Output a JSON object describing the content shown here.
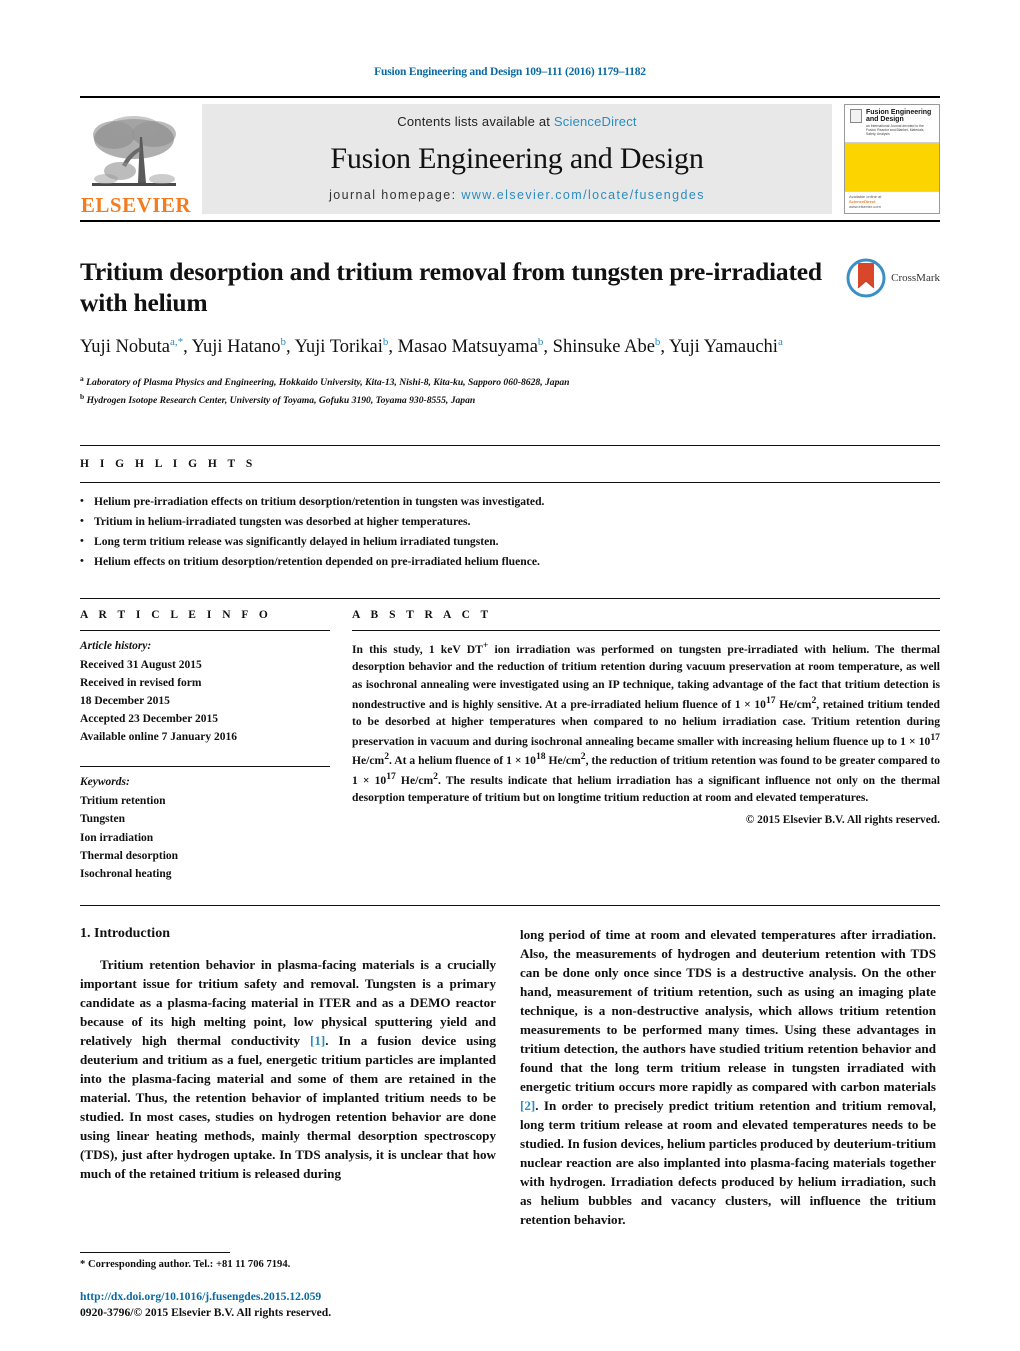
{
  "running_head": "Fusion Engineering and Design 109–111 (2016) 1179–1182",
  "masthead": {
    "publisher_name": "ELSEVIER",
    "contents_prefix": "Contents lists available at ",
    "contents_link": "ScienceDirect",
    "journal_title": "Fusion Engineering and Design",
    "homepage_label": "journal homepage: ",
    "homepage_url": "www.elsevier.com/locate/fusengdes",
    "cover": {
      "title_line1": "Fusion Engineering",
      "title_line2": "and Design",
      "subtitle": "an International Journal devoted to the Fusion Reactor and Blanket, Materials, Safety, Analysis",
      "footer_text": "Available online at",
      "footer_brand": "ScienceDirect",
      "footer_url": "www.elsevier.com"
    }
  },
  "article": {
    "title": "Tritium desorption and tritium removal from tungsten pre-irradiated with helium",
    "crossmark_label": "CrossMark",
    "authors_html": "Yuji Nobuta<sup>a,</sup><sup>*</sup>, Yuji Hatano<sup>b</sup>, Yuji Torikai<sup>b</sup>, Masao Matsuyama<sup>b</sup>, Shinsuke Abe<sup>b</sup>, Yuji Yamauchi<sup>a</sup>",
    "affiliations": [
      {
        "marker": "a",
        "text": "Laboratory of Plasma Physics and Engineering, Hokkaido University, Kita-13, Nishi-8, Kita-ku, Sapporo 060-8628, Japan"
      },
      {
        "marker": "b",
        "text": "Hydrogen Isotope Research Center, University of Toyama, Gofuku 3190, Toyama 930-8555, Japan"
      }
    ]
  },
  "highlights": {
    "heading": "H I G H L I G H T S",
    "items": [
      "Helium pre-irradiation effects on tritium desorption/retention in tungsten was investigated.",
      "Tritium in helium-irradiated tungsten was desorbed at higher temperatures.",
      "Long term tritium release was significantly delayed in helium irradiated tungsten.",
      "Helium effects on tritium desorption/retention depended on pre-irradiated helium fluence."
    ]
  },
  "article_info": {
    "heading": "A R T I C L E    I N F O",
    "history_label": "Article history:",
    "history_lines": [
      "Received 31 August 2015",
      "Received in revised form",
      "18 December 2015",
      "Accepted 23 December 2015",
      "Available online 7 January 2016"
    ],
    "keywords_label": "Keywords:",
    "keywords": [
      "Tritium retention",
      "Tungsten",
      "Ion irradiation",
      "Thermal desorption",
      "Isochronal heating"
    ]
  },
  "abstract": {
    "heading": "A B S T R A C T",
    "text_html": "In this study, 1 keV DT<sup>+</sup> ion irradiation was performed on tungsten pre-irradiated with helium. The thermal desorption behavior and the reduction of tritium retention during vacuum preservation at room temperature, as well as isochronal annealing were investigated using an IP technique, taking advantage of the fact that tritium detection is nondestructive and is highly sensitive. At a pre-irradiated helium fluence of 1 &times; 10<sup>17</sup> He/cm<sup>2</sup>, retained tritium tended to be desorbed at higher temperatures when compared to no helium irradiation case. Tritium retention during preservation in vacuum and during isochronal annealing became smaller with increasing helium fluence up to 1 &times; 10<sup>17</sup> He/cm<sup>2</sup>. At a helium fluence of 1 &times; 10<sup>18</sup> He/cm<sup>2</sup>, the reduction of tritium retention was found to be greater compared to 1 &times; 10<sup>17</sup> He/cm<sup>2</sup>. The results indicate that helium irradiation has a significant influence not only on the thermal desorption temperature of tritium but on longtime tritium reduction at room and elevated temperatures.",
    "copyright": "© 2015 Elsevier B.V. All rights reserved."
  },
  "body": {
    "section_heading": "1.  Introduction",
    "left_paragraph_html": "Tritium retention behavior in plasma-facing materials is a crucially important issue for tritium safety and removal. Tungsten is a primary candidate as a plasma-facing material in ITER and as a DEMO reactor because of its high melting point, low physical sputtering yield and relatively high thermal conductivity <span class=\"ref\">[1]</span>. In a fusion device using deuterium and tritium as a fuel, energetic tritium particles are implanted into the plasma-facing material and some of them are retained in the material. Thus, the retention behavior of implanted tritium needs to be studied. In most cases, studies on hydrogen retention behavior are done using linear heating methods, mainly thermal desorption spectroscopy (TDS), just after hydrogen uptake. In TDS analysis, it is unclear that how much of the retained tritium is released during",
    "right_paragraph_html": "long period of time at room and elevated temperatures after irradiation. Also, the measurements of hydrogen and deuterium retention with TDS can be done only once since TDS is a destructive analysis. On the other hand, measurement of tritium retention, such as using an imaging plate technique, is a non-destructive analysis, which allows tritium retention measurements to be performed many times. Using these advantages in tritium detection, the authors have studied tritium retention behavior and found that the long term tritium release in tungsten irradiated with energetic tritium occurs more rapidly as compared with carbon materials <span class=\"ref\">[2]</span>. In order to precisely predict tritium retention and tritium removal, long term tritium release at room and elevated temperatures needs to be studied. In fusion devices, helium particles produced by deuterium-tritium nuclear reaction are also implanted into plasma-facing materials together with hydrogen. Irradiation defects produced by helium irradiation, such as helium bubbles and vacancy clusters, will influence the tritium retention behavior."
  },
  "footnote": "*  Corresponding author. Tel.: +81 11 706 7194.",
  "footer": {
    "doi": "http://dx.doi.org/10.1016/j.fusengdes.2015.12.059",
    "issn_line": "0920-3796/© 2015 Elsevier B.V. All rights reserved."
  },
  "colors": {
    "link_blue": "#2b8cbe",
    "header_blue": "#0b6aa2",
    "elsevier_orange": "#f47c20",
    "cover_yellow": "#fcd500"
  }
}
